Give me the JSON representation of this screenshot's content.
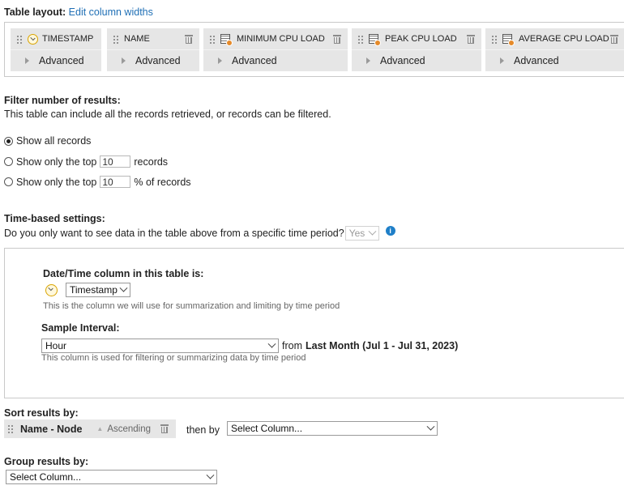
{
  "table_layout": {
    "label": "Table layout:",
    "edit_link": "Edit column widths",
    "columns": [
      {
        "name": "TIMESTAMP",
        "advanced": "Advanced",
        "icon": "clock-icon"
      },
      {
        "name": "NAME",
        "advanced": "Advanced",
        "icon": ""
      },
      {
        "name": "MINIMUM CPU LOAD",
        "advanced": "Advanced",
        "icon": "table-icon"
      },
      {
        "name": "PEAK CPU LOAD",
        "advanced": "Advanced",
        "icon": "table-icon"
      },
      {
        "name": "AVERAGE CPU LOAD",
        "advanced": "Advanced",
        "icon": "table-icon"
      }
    ]
  },
  "filter": {
    "title": "Filter number of results:",
    "description": "This table can include all the records retrieved, or records can be filtered.",
    "options": [
      {
        "label": "Show all records",
        "selected": true
      },
      {
        "label_before": "Show only the top",
        "value": "10",
        "label_after": "records",
        "selected": false
      },
      {
        "label_before": "Show only the top",
        "value": "10",
        "label_after": "% of records",
        "selected": false
      }
    ]
  },
  "time_settings": {
    "title": "Time-based settings:",
    "question": "Do you only want to see data in the table above from a specific time period?",
    "answer": "Yes",
    "datetime_label": "Date/Time column in this table is:",
    "datetime_value": "Timestamp",
    "datetime_hint": "This is the column we will use for summarization and limiting by time period",
    "interval_label": "Sample Interval:",
    "interval_value": "Hour",
    "from_label": "from",
    "from_value": "Last Month (Jul 1 - Jul 31, 2023)",
    "interval_hint": "This column is used for filtering or summarizing data by time period"
  },
  "sort": {
    "title": "Sort results by:",
    "field": "Name - Node",
    "direction": "Ascending",
    "then_by": "then by",
    "then_select": "Select Column..."
  },
  "group": {
    "title": "Group results by:",
    "select": "Select Column..."
  }
}
